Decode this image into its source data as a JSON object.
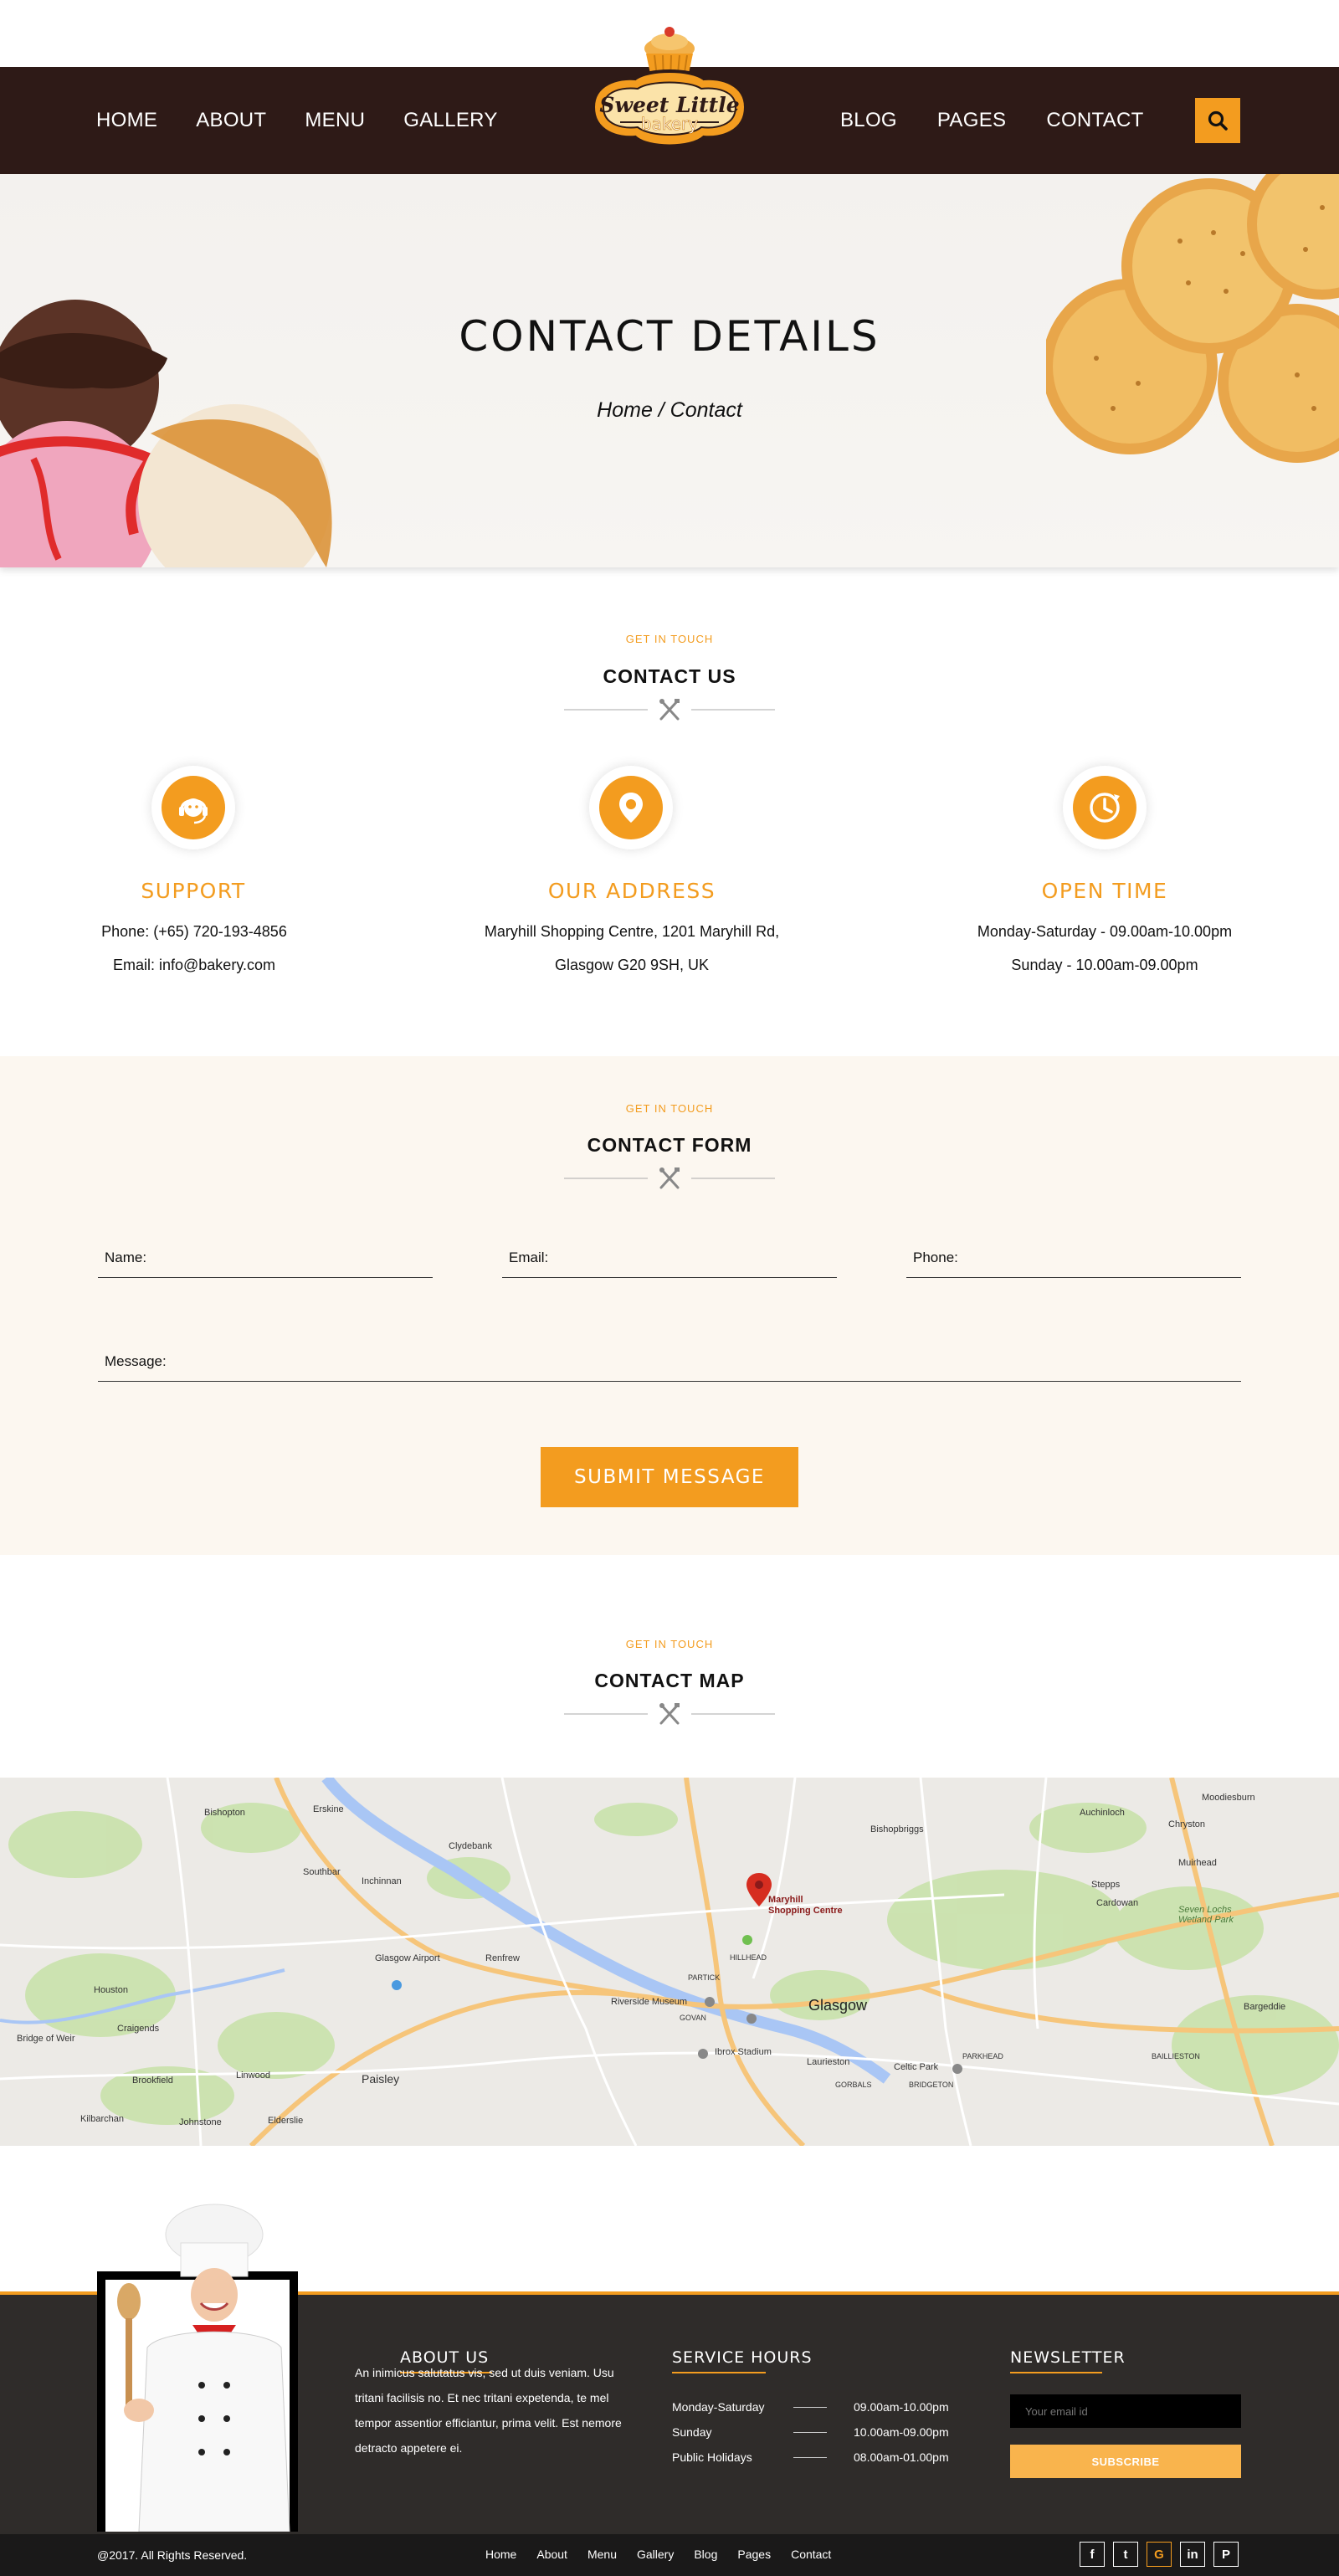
{
  "nav": {
    "left": [
      "HOME",
      "ABOUT",
      "MENU",
      "GALLERY"
    ],
    "right": [
      "BLOG",
      "PAGES",
      "CONTACT"
    ]
  },
  "logo": {
    "line1": "Sweet Little",
    "line2": "bakery"
  },
  "hero": {
    "title": "CONTACT DETAILS",
    "breadcrumb": "Home / Contact"
  },
  "contact_us": {
    "kicker": "GET IN TOUCH",
    "title": "CONTACT US",
    "support": {
      "heading": "SUPPORT",
      "line1": "Phone: (+65) 720-193-4856",
      "line2": "Email: info@bakery.com"
    },
    "address": {
      "heading": "OUR ADDRESS",
      "line1": "Maryhill Shopping Centre, 1201 Maryhill Rd,",
      "line2": "Glasgow G20 9SH, UK"
    },
    "open_time": {
      "heading": "OPEN TIME",
      "line1": "Monday-Saturday  - 09.00am-10.00pm",
      "line2": "Sunday - 10.00am-09.00pm"
    }
  },
  "contact_form": {
    "kicker": "GET IN TOUCH",
    "title": "CONTACT FORM",
    "name_label": "Name:",
    "email_label": "Email:",
    "phone_label": "Phone:",
    "message_label": "Message:",
    "submit": "SUBMIT MESSAGE"
  },
  "contact_map": {
    "kicker": "GET IN TOUCH",
    "title": "CONTACT MAP",
    "pin_label_1": "Maryhill",
    "pin_label_2": "Shopping Centre",
    "labels": {
      "bishopton": "Bishopton",
      "erskine": "Erskine",
      "clydebank": "Clydebank",
      "southbar": "Southbar",
      "inchinnan": "Inchinnan",
      "glasgow_airport": "Glasgow Airport",
      "renfrew": "Renfrew",
      "houston": "Houston",
      "craigends": "Craigends",
      "bridge_of_weir": "Bridge of Weir",
      "brookfield": "Brookfield",
      "linwood": "Linwood",
      "paisley": "Paisley",
      "kilbarchan": "Kilbarchan",
      "johnstone": "Johnstone",
      "elderslie": "Elderslie",
      "bishopbriggs": "Bishopbriggs",
      "auchinloch": "Auchinloch",
      "chryston": "Chryston",
      "moodiesburn": "Moodiesburn",
      "muirhead": "Muirhead",
      "stepps": "Stepps",
      "cardowan": "Cardowan",
      "seven_lochs": "Seven Lochs Wetland Park",
      "barrgeddie": "Bargeddie",
      "glasgow": "Glasgow",
      "riverside": "Riverside Museum",
      "ibrox": "Ibrox Stadium",
      "celtic_park": "Celtic Park",
      "laurieston": "Laurieston",
      "partick": "PARTICK",
      "hillhead": "HILLHEAD",
      "govan": "GOVAN",
      "parkhead": "PARKHEAD",
      "bridgeton": "BRIDGETON",
      "ballieston": "BAILLIESTON",
      "gorbals": "GORBALS"
    }
  },
  "footer": {
    "about_heading": "ABOUT US",
    "about_text": "An inimicus salutatus vis, sed ut duis veniam. Usu tritani facilisis no. Et nec tritani expetenda, te mel tempor assentior efficiantur, prima velit. Est nemore detracto appetere ei.",
    "hours_heading": "SERVICE HOURS",
    "hours": [
      {
        "day": "Monday-Saturday",
        "time": "09.00am-10.00pm"
      },
      {
        "day": "Sunday",
        "time": "10.00am-09.00pm"
      },
      {
        "day": "Public Holidays",
        "time": "08.00am-01.00pm"
      }
    ],
    "newsletter_heading": "NEWSLETTER",
    "email_placeholder": "Your email id",
    "subscribe": "SUBSCRIBE"
  },
  "bottombar": {
    "copyright": "@2017. All Rights Reserved.",
    "links": [
      "Home",
      "About",
      "Menu",
      "Gallery",
      "Blog",
      "Pages",
      "Contact"
    ],
    "socials": [
      "f",
      "t",
      "G",
      "in",
      "P"
    ]
  },
  "colors": {
    "accent": "#f39c1f",
    "nav_bg": "#2e1a17",
    "footer_bg": "#2f2c2a",
    "form_bg": "#fcf7f0"
  }
}
